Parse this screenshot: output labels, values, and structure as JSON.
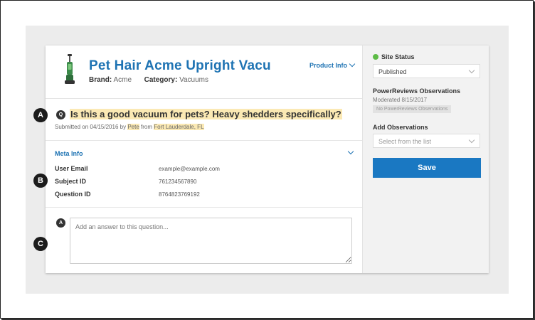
{
  "product": {
    "title": "Pet Hair Acme Upright Vacuu...",
    "brand_label": "Brand:",
    "brand_value": "Acme",
    "category_label": "Category:",
    "category_value": "Vacuums",
    "info_link": "Product Info"
  },
  "question": {
    "icon_letter": "Q",
    "text": "Is this a good vacuum for pets? Heavy shedders specifically?",
    "submitted_prefix": "Submitted on 04/15/2016 by",
    "author": "Pete",
    "from_word": "from",
    "location": "Fort Lauderdale, FL"
  },
  "meta": {
    "title": "Meta Info",
    "rows": [
      {
        "key": "User Email",
        "value": "example@example.com"
      },
      {
        "key": "Subject ID",
        "value": "761234567890"
      },
      {
        "key": "Question ID",
        "value": "8764823769192"
      }
    ]
  },
  "answer": {
    "icon_letter": "A",
    "placeholder": "Add an answer to this question..."
  },
  "sidebar": {
    "site_status_label": "Site Status",
    "site_status_value": "Published",
    "powerreviews_title": "PowerReviews Observations",
    "moderated": "Moderated 8/15/2017",
    "observations_badge": "No PowerReviews Observations",
    "add_observations_label": "Add Observations",
    "add_observations_placeholder": "Select from the list",
    "save_label": "Save"
  },
  "callouts": [
    "A",
    "B",
    "C"
  ],
  "colors": {
    "accent": "#1e73b3",
    "save_button": "#1a78c2",
    "highlight": "#fbe9b4",
    "status_green": "#5dbb46"
  }
}
